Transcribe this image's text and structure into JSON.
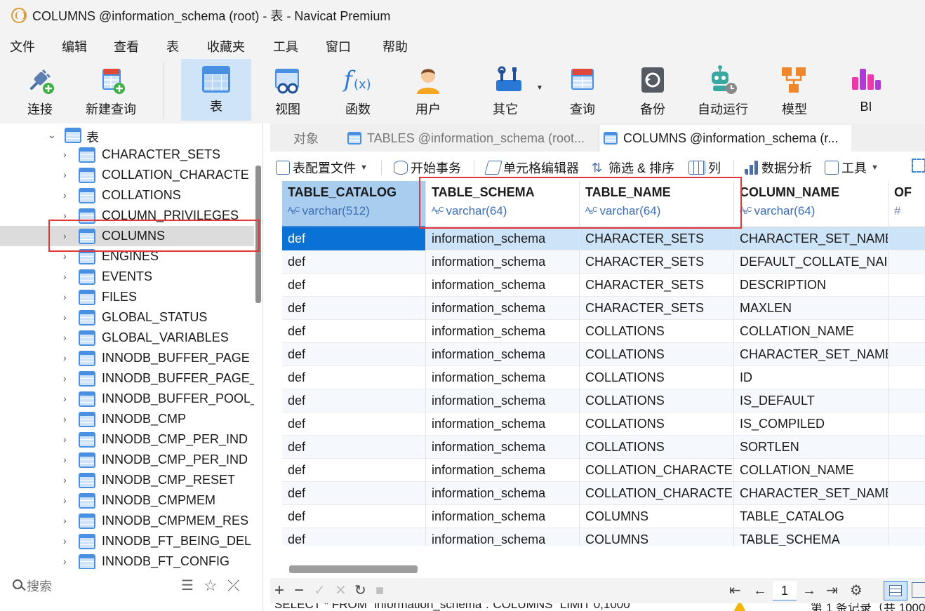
{
  "window": {
    "title": "COLUMNS @information_schema (root) - 表 - Navicat Premium"
  },
  "menu": [
    "文件",
    "编辑",
    "查看",
    "表",
    "收藏夹",
    "工具",
    "窗口",
    "帮助"
  ],
  "toolbar": {
    "buttons": [
      "连接",
      "新建查询",
      "表",
      "视图",
      "函数",
      "用户",
      "其它",
      "查询",
      "备份",
      "自动运行",
      "模型",
      "BI"
    ],
    "active": "表"
  },
  "sidebar": {
    "parent": "表",
    "items": [
      "CHARACTER_SETS",
      "COLLATION_CHARACTE",
      "COLLATIONS",
      "COLUMN_PRIVILEGES",
      "COLUMNS",
      "ENGINES",
      "EVENTS",
      "FILES",
      "GLOBAL_STATUS",
      "GLOBAL_VARIABLES",
      "INNODB_BUFFER_PAGE",
      "INNODB_BUFFER_PAGE_",
      "INNODB_BUFFER_POOL_",
      "INNODB_CMP",
      "INNODB_CMP_PER_IND",
      "INNODB_CMP_PER_IND",
      "INNODB_CMP_RESET",
      "INNODB_CMPMEM",
      "INNODB_CMPMEM_RES",
      "INNODB_FT_BEING_DEL",
      "INNODB_FT_CONFIG"
    ],
    "selected": "COLUMNS",
    "search_placeholder": "搜索"
  },
  "tabs": [
    "对象",
    "TABLES @information_schema (root...",
    "COLUMNS @information_schema (r..."
  ],
  "subtoolbar": [
    "表配置文件",
    "开始事务",
    "单元格编辑器",
    "筛选 & 排序",
    "列",
    "数据分析",
    "工具"
  ],
  "grid": {
    "columns": [
      {
        "name": "TABLE_CATALOG",
        "type": "varchar(512)"
      },
      {
        "name": "TABLE_SCHEMA",
        "type": "varchar(64)"
      },
      {
        "name": "TABLE_NAME",
        "type": "varchar(64)"
      },
      {
        "name": "COLUMN_NAME",
        "type": "varchar(64)"
      },
      {
        "name": "OF",
        "type": "#"
      }
    ],
    "rows": [
      [
        "def",
        "information_schema",
        "CHARACTER_SETS",
        "CHARACTER_SET_NAME"
      ],
      [
        "def",
        "information_schema",
        "CHARACTER_SETS",
        "DEFAULT_COLLATE_NAI"
      ],
      [
        "def",
        "information_schema",
        "CHARACTER_SETS",
        "DESCRIPTION"
      ],
      [
        "def",
        "information_schema",
        "CHARACTER_SETS",
        "MAXLEN"
      ],
      [
        "def",
        "information_schema",
        "COLLATIONS",
        "COLLATION_NAME"
      ],
      [
        "def",
        "information_schema",
        "COLLATIONS",
        "CHARACTER_SET_NAME"
      ],
      [
        "def",
        "information_schema",
        "COLLATIONS",
        "ID"
      ],
      [
        "def",
        "information_schema",
        "COLLATIONS",
        "IS_DEFAULT"
      ],
      [
        "def",
        "information_schema",
        "COLLATIONS",
        "IS_COMPILED"
      ],
      [
        "def",
        "information_schema",
        "COLLATIONS",
        "SORTLEN"
      ],
      [
        "def",
        "information_schema",
        "COLLATION_CHARACTE",
        "COLLATION_NAME"
      ],
      [
        "def",
        "information_schema",
        "COLLATION_CHARACTE",
        "CHARACTER_SET_NAME"
      ],
      [
        "def",
        "information_schema",
        "COLUMNS",
        "TABLE_CATALOG"
      ],
      [
        "def",
        "information_schema",
        "COLUMNS",
        "TABLE_SCHEMA"
      ]
    ]
  },
  "pager": {
    "page": "1"
  },
  "status": {
    "sql": "SELECT * FROM `information_schema`.`COLUMNS` LIMIT 0,1000",
    "records": "第 1 条记录（共 1000"
  },
  "colors": {
    "accent": "#0a72d4",
    "highlight": "#e0373a",
    "toolbar_active": "#cfe4f7"
  }
}
